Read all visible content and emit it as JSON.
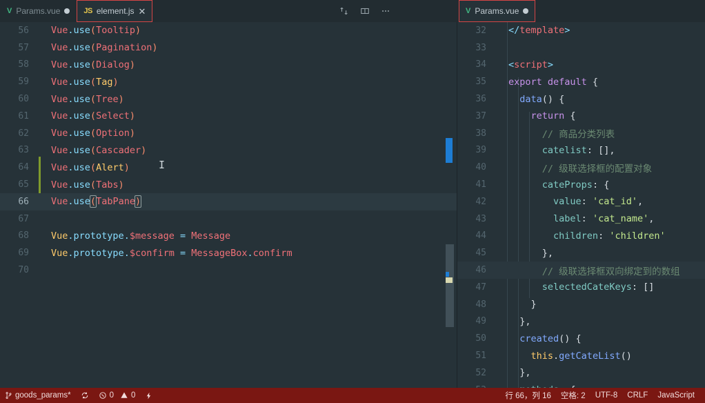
{
  "window": {
    "theme_background": "#263238",
    "tabbar_background": "#222c31",
    "accent_outline": "#d64545",
    "statusbar_background": "#7a1712"
  },
  "tabbar": {
    "left_group": [
      {
        "label": "Params.vue",
        "icon": "vue-file-icon",
        "state": "dirty",
        "active": false,
        "outlined": false
      },
      {
        "label": "element.js",
        "icon": "js-file-icon",
        "state": "closeable",
        "active": true,
        "outlined": true
      }
    ],
    "actions": [
      {
        "name": "toggle-editor-layout-icon",
        "title": "Toggle Vertical/Horizontal Editor Layout"
      },
      {
        "name": "split-editor-icon",
        "title": "Split Editor"
      },
      {
        "name": "more-actions-icon",
        "title": "More Actions..."
      }
    ],
    "right_group": [
      {
        "label": "Params.vue",
        "icon": "vue-file-icon",
        "state": "dirty",
        "active": true,
        "outlined": true
      }
    ]
  },
  "left_editor": {
    "file": "element.js",
    "first_line": 56,
    "current_line": 66,
    "git_change_lines": [
      64,
      65,
      66
    ],
    "lines": [
      {
        "n": 56,
        "tokens": [
          {
            "t": "Vue",
            "c": "t-vue"
          },
          {
            "t": ".",
            "c": "t-dot"
          },
          {
            "t": "use",
            "c": "t-prop"
          },
          {
            "t": "(",
            "c": "t-paren"
          },
          {
            "t": "Tooltip",
            "c": "t-arg"
          },
          {
            "t": ")",
            "c": "t-paren"
          }
        ]
      },
      {
        "n": 57,
        "tokens": [
          {
            "t": "Vue",
            "c": "t-vue"
          },
          {
            "t": ".",
            "c": "t-dot"
          },
          {
            "t": "use",
            "c": "t-prop"
          },
          {
            "t": "(",
            "c": "t-paren"
          },
          {
            "t": "Pagination",
            "c": "t-arg"
          },
          {
            "t": ")",
            "c": "t-paren"
          }
        ]
      },
      {
        "n": 58,
        "tokens": [
          {
            "t": "Vue",
            "c": "t-vue"
          },
          {
            "t": ".",
            "c": "t-dot"
          },
          {
            "t": "use",
            "c": "t-prop"
          },
          {
            "t": "(",
            "c": "t-paren"
          },
          {
            "t": "Dialog",
            "c": "t-arg"
          },
          {
            "t": ")",
            "c": "t-paren"
          }
        ]
      },
      {
        "n": 59,
        "tokens": [
          {
            "t": "Vue",
            "c": "t-vue"
          },
          {
            "t": ".",
            "c": "t-dot"
          },
          {
            "t": "use",
            "c": "t-prop"
          },
          {
            "t": "(",
            "c": "t-paren"
          },
          {
            "t": "Tag",
            "c": "t-argwarm"
          },
          {
            "t": ")",
            "c": "t-paren"
          }
        ]
      },
      {
        "n": 60,
        "tokens": [
          {
            "t": "Vue",
            "c": "t-vue"
          },
          {
            "t": ".",
            "c": "t-dot"
          },
          {
            "t": "use",
            "c": "t-prop"
          },
          {
            "t": "(",
            "c": "t-paren"
          },
          {
            "t": "Tree",
            "c": "t-arg"
          },
          {
            "t": ")",
            "c": "t-paren"
          }
        ]
      },
      {
        "n": 61,
        "tokens": [
          {
            "t": "Vue",
            "c": "t-vue"
          },
          {
            "t": ".",
            "c": "t-dot"
          },
          {
            "t": "use",
            "c": "t-prop"
          },
          {
            "t": "(",
            "c": "t-paren"
          },
          {
            "t": "Select",
            "c": "t-arg"
          },
          {
            "t": ")",
            "c": "t-paren"
          }
        ]
      },
      {
        "n": 62,
        "tokens": [
          {
            "t": "Vue",
            "c": "t-vue"
          },
          {
            "t": ".",
            "c": "t-dot"
          },
          {
            "t": "use",
            "c": "t-prop"
          },
          {
            "t": "(",
            "c": "t-paren"
          },
          {
            "t": "Option",
            "c": "t-arg"
          },
          {
            "t": ")",
            "c": "t-paren"
          }
        ]
      },
      {
        "n": 63,
        "tokens": [
          {
            "t": "Vue",
            "c": "t-vue"
          },
          {
            "t": ".",
            "c": "t-dot"
          },
          {
            "t": "use",
            "c": "t-prop"
          },
          {
            "t": "(",
            "c": "t-paren"
          },
          {
            "t": "Cascader",
            "c": "t-arg"
          },
          {
            "t": ")",
            "c": "t-paren"
          }
        ]
      },
      {
        "n": 64,
        "tokens": [
          {
            "t": "Vue",
            "c": "t-vue"
          },
          {
            "t": ".",
            "c": "t-dot"
          },
          {
            "t": "use",
            "c": "t-prop"
          },
          {
            "t": "(",
            "c": "t-paren"
          },
          {
            "t": "Alert",
            "c": "t-argwarm"
          },
          {
            "t": ")",
            "c": "t-paren"
          }
        ]
      },
      {
        "n": 65,
        "tokens": [
          {
            "t": "Vue",
            "c": "t-vue"
          },
          {
            "t": ".",
            "c": "t-dot"
          },
          {
            "t": "use",
            "c": "t-prop"
          },
          {
            "t": "(",
            "c": "t-paren"
          },
          {
            "t": "Tabs",
            "c": "t-arg"
          },
          {
            "t": ")",
            "c": "t-paren"
          }
        ]
      },
      {
        "n": 66,
        "current": true,
        "tokens": [
          {
            "t": "Vue",
            "c": "t-vue"
          },
          {
            "t": ".",
            "c": "t-dot"
          },
          {
            "t": "use",
            "c": "t-prop"
          },
          {
            "t": "(",
            "c": "t-paren",
            "bracket": true
          },
          {
            "t": "TabPane",
            "c": "t-arg"
          },
          {
            "t": ")",
            "c": "t-paren",
            "bracket": true
          }
        ]
      },
      {
        "n": 67,
        "tokens": []
      },
      {
        "n": 68,
        "tokens": [
          {
            "t": "Vue",
            "c": "t-vueorg"
          },
          {
            "t": ".",
            "c": "t-dot"
          },
          {
            "t": "prototype",
            "c": "t-prop"
          },
          {
            "t": ".",
            "c": "t-dot"
          },
          {
            "t": "$message",
            "c": "t-id"
          },
          {
            "t": " = ",
            "c": "t-dot"
          },
          {
            "t": "Message",
            "c": "t-id"
          }
        ]
      },
      {
        "n": 69,
        "tokens": [
          {
            "t": "Vue",
            "c": "t-vueorg"
          },
          {
            "t": ".",
            "c": "t-dot"
          },
          {
            "t": "prototype",
            "c": "t-prop"
          },
          {
            "t": ".",
            "c": "t-dot"
          },
          {
            "t": "$confirm",
            "c": "t-id"
          },
          {
            "t": " = ",
            "c": "t-dot"
          },
          {
            "t": "MessageBox",
            "c": "t-id"
          },
          {
            "t": ".",
            "c": "t-dot"
          },
          {
            "t": "confirm",
            "c": "t-id"
          }
        ]
      },
      {
        "n": 70,
        "tokens": []
      }
    ]
  },
  "right_editor": {
    "file": "Params.vue",
    "first_line": 32,
    "lines": [
      {
        "n": 32,
        "tokens": [
          {
            "t": "</",
            "c": "t-tagbr"
          },
          {
            "t": "template",
            "c": "t-tag"
          },
          {
            "t": ">",
            "c": "t-tagbr"
          }
        ]
      },
      {
        "n": 33,
        "tokens": []
      },
      {
        "n": 34,
        "tokens": [
          {
            "t": "<",
            "c": "t-tagbr"
          },
          {
            "t": "script",
            "c": "t-tag"
          },
          {
            "t": ">",
            "c": "t-tagbr"
          }
        ]
      },
      {
        "n": 35,
        "tokens": [
          {
            "t": "export default",
            "c": "t-kw"
          },
          {
            "t": " {",
            "c": "t-brace"
          }
        ]
      },
      {
        "n": 36,
        "indent": 1,
        "tokens": [
          {
            "t": "  ",
            "c": "t-plain"
          },
          {
            "t": "data",
            "c": "t-fn"
          },
          {
            "t": "() {",
            "c": "t-brace"
          }
        ]
      },
      {
        "n": 37,
        "indent": 2,
        "tokens": [
          {
            "t": "    ",
            "c": "t-plain"
          },
          {
            "t": "return",
            "c": "t-kw"
          },
          {
            "t": " {",
            "c": "t-brace"
          }
        ]
      },
      {
        "n": 38,
        "indent": 3,
        "tokens": [
          {
            "t": "      ",
            "c": "t-plain"
          },
          {
            "t": "// 商品分类列表",
            "c": "t-comment"
          }
        ]
      },
      {
        "n": 39,
        "indent": 3,
        "tokens": [
          {
            "t": "      ",
            "c": "t-plain"
          },
          {
            "t": "catelist",
            "c": "t-key"
          },
          {
            "t": ": [],",
            "c": "t-brace"
          }
        ]
      },
      {
        "n": 40,
        "indent": 3,
        "tokens": [
          {
            "t": "      ",
            "c": "t-plain"
          },
          {
            "t": "// 级联选择框的配置对象",
            "c": "t-comment"
          }
        ]
      },
      {
        "n": 41,
        "indent": 3,
        "tokens": [
          {
            "t": "      ",
            "c": "t-plain"
          },
          {
            "t": "cateProps",
            "c": "t-key"
          },
          {
            "t": ": {",
            "c": "t-brace"
          }
        ]
      },
      {
        "n": 42,
        "indent": 4,
        "tokens": [
          {
            "t": "        ",
            "c": "t-plain"
          },
          {
            "t": "value",
            "c": "t-key"
          },
          {
            "t": ": ",
            "c": "t-brace"
          },
          {
            "t": "'cat_id'",
            "c": "t-str"
          },
          {
            "t": ",",
            "c": "t-brace"
          }
        ]
      },
      {
        "n": 43,
        "indent": 4,
        "tokens": [
          {
            "t": "        ",
            "c": "t-plain"
          },
          {
            "t": "label",
            "c": "t-key"
          },
          {
            "t": ": ",
            "c": "t-brace"
          },
          {
            "t": "'cat_name'",
            "c": "t-str"
          },
          {
            "t": ",",
            "c": "t-brace"
          }
        ]
      },
      {
        "n": 44,
        "indent": 4,
        "tokens": [
          {
            "t": "        ",
            "c": "t-plain"
          },
          {
            "t": "children",
            "c": "t-key"
          },
          {
            "t": ": ",
            "c": "t-brace"
          },
          {
            "t": "'children'",
            "c": "t-str"
          }
        ]
      },
      {
        "n": 45,
        "indent": 3,
        "tokens": [
          {
            "t": "      ",
            "c": "t-plain"
          },
          {
            "t": "},",
            "c": "t-brace"
          }
        ]
      },
      {
        "n": 46,
        "indent": 3,
        "highlight": true,
        "tokens": [
          {
            "t": "      ",
            "c": "t-plain"
          },
          {
            "t": "// 级联选择框双向绑定到的数组",
            "c": "t-comment"
          }
        ]
      },
      {
        "n": 47,
        "indent": 3,
        "tokens": [
          {
            "t": "      ",
            "c": "t-plain"
          },
          {
            "t": "selectedCateKeys",
            "c": "t-key"
          },
          {
            "t": ": []",
            "c": "t-brace"
          }
        ]
      },
      {
        "n": 48,
        "indent": 2,
        "tokens": [
          {
            "t": "    ",
            "c": "t-plain"
          },
          {
            "t": "}",
            "c": "t-brace"
          }
        ]
      },
      {
        "n": 49,
        "indent": 1,
        "tokens": [
          {
            "t": "  ",
            "c": "t-plain"
          },
          {
            "t": "},",
            "c": "t-brace"
          }
        ]
      },
      {
        "n": 50,
        "indent": 1,
        "tokens": [
          {
            "t": "  ",
            "c": "t-plain"
          },
          {
            "t": "created",
            "c": "t-fn"
          },
          {
            "t": "() {",
            "c": "t-brace"
          }
        ]
      },
      {
        "n": 51,
        "indent": 2,
        "tokens": [
          {
            "t": "    ",
            "c": "t-plain"
          },
          {
            "t": "this",
            "c": "t-this"
          },
          {
            "t": ".",
            "c": "t-brace"
          },
          {
            "t": "getCateList",
            "c": "t-fn"
          },
          {
            "t": "()",
            "c": "t-brace"
          }
        ]
      },
      {
        "n": 52,
        "indent": 1,
        "tokens": [
          {
            "t": "  ",
            "c": "t-plain"
          },
          {
            "t": "},",
            "c": "t-brace"
          }
        ]
      },
      {
        "n": 53,
        "indent": 1,
        "tokens": [
          {
            "t": "  ",
            "c": "t-plain"
          },
          {
            "t": "methods",
            "c": "t-key"
          },
          {
            "t": ": {",
            "c": "t-brace"
          }
        ]
      }
    ]
  },
  "statusbar": {
    "branch": "goods_params*",
    "sync_icon": "sync-icon",
    "errors_icon": "error-icon",
    "errors": "0",
    "warnings_icon": "warning-icon",
    "warnings": "0",
    "bolt_icon": "lightning-bolt-icon",
    "cursor_position": "行 66，列 16",
    "indentation": "空格: 2",
    "encoding": "UTF-8",
    "eol": "CRLF",
    "language": "JavaScript"
  }
}
